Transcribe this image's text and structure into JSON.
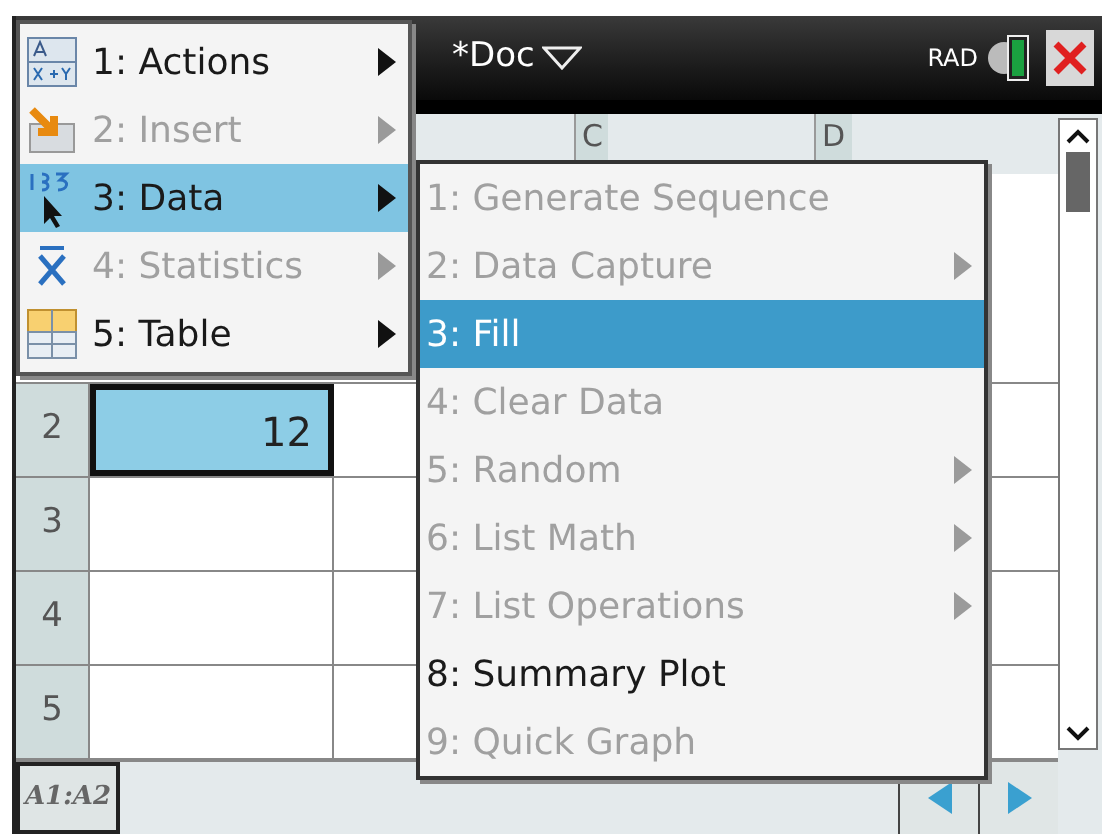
{
  "title_bar": {
    "document": "*Doc",
    "mode": "RAD"
  },
  "menu": [
    {
      "label": "1: Actions",
      "disabled": false,
      "selected": false,
      "submenu": true,
      "kind": "actions"
    },
    {
      "label": "2: Insert",
      "disabled": true,
      "selected": false,
      "submenu": true,
      "kind": "insert"
    },
    {
      "label": "3: Data",
      "disabled": false,
      "selected": true,
      "submenu": true,
      "kind": "data"
    },
    {
      "label": "4: Statistics",
      "disabled": true,
      "selected": false,
      "submenu": true,
      "kind": "stats"
    },
    {
      "label": "5: Table",
      "disabled": false,
      "selected": false,
      "submenu": true,
      "kind": "table"
    }
  ],
  "submenu": [
    {
      "label": "1: Generate Sequence",
      "disabled": true,
      "selected": false,
      "submenu": false
    },
    {
      "label": "2: Data Capture",
      "disabled": true,
      "selected": false,
      "submenu": true
    },
    {
      "label": "3: Fill",
      "disabled": false,
      "selected": true,
      "submenu": false
    },
    {
      "label": "4: Clear Data",
      "disabled": true,
      "selected": false,
      "submenu": false
    },
    {
      "label": "5: Random",
      "disabled": true,
      "selected": false,
      "submenu": true
    },
    {
      "label": "6: List Math",
      "disabled": true,
      "selected": false,
      "submenu": true
    },
    {
      "label": "7: List Operations",
      "disabled": true,
      "selected": false,
      "submenu": true
    },
    {
      "label": "8: Summary Plot",
      "disabled": false,
      "selected": false,
      "submenu": false
    },
    {
      "label": "9: Quick Graph",
      "disabled": true,
      "selected": false,
      "submenu": false
    }
  ],
  "sheet": {
    "columns": [
      "C",
      "D"
    ],
    "rows": [
      {
        "number": "2",
        "cell_a": "12",
        "selected": true
      },
      {
        "number": "3",
        "selected": false
      },
      {
        "number": "4",
        "selected": false
      },
      {
        "number": "5",
        "selected": false
      }
    ]
  },
  "status_bar": {
    "selection": "A1:A2"
  }
}
